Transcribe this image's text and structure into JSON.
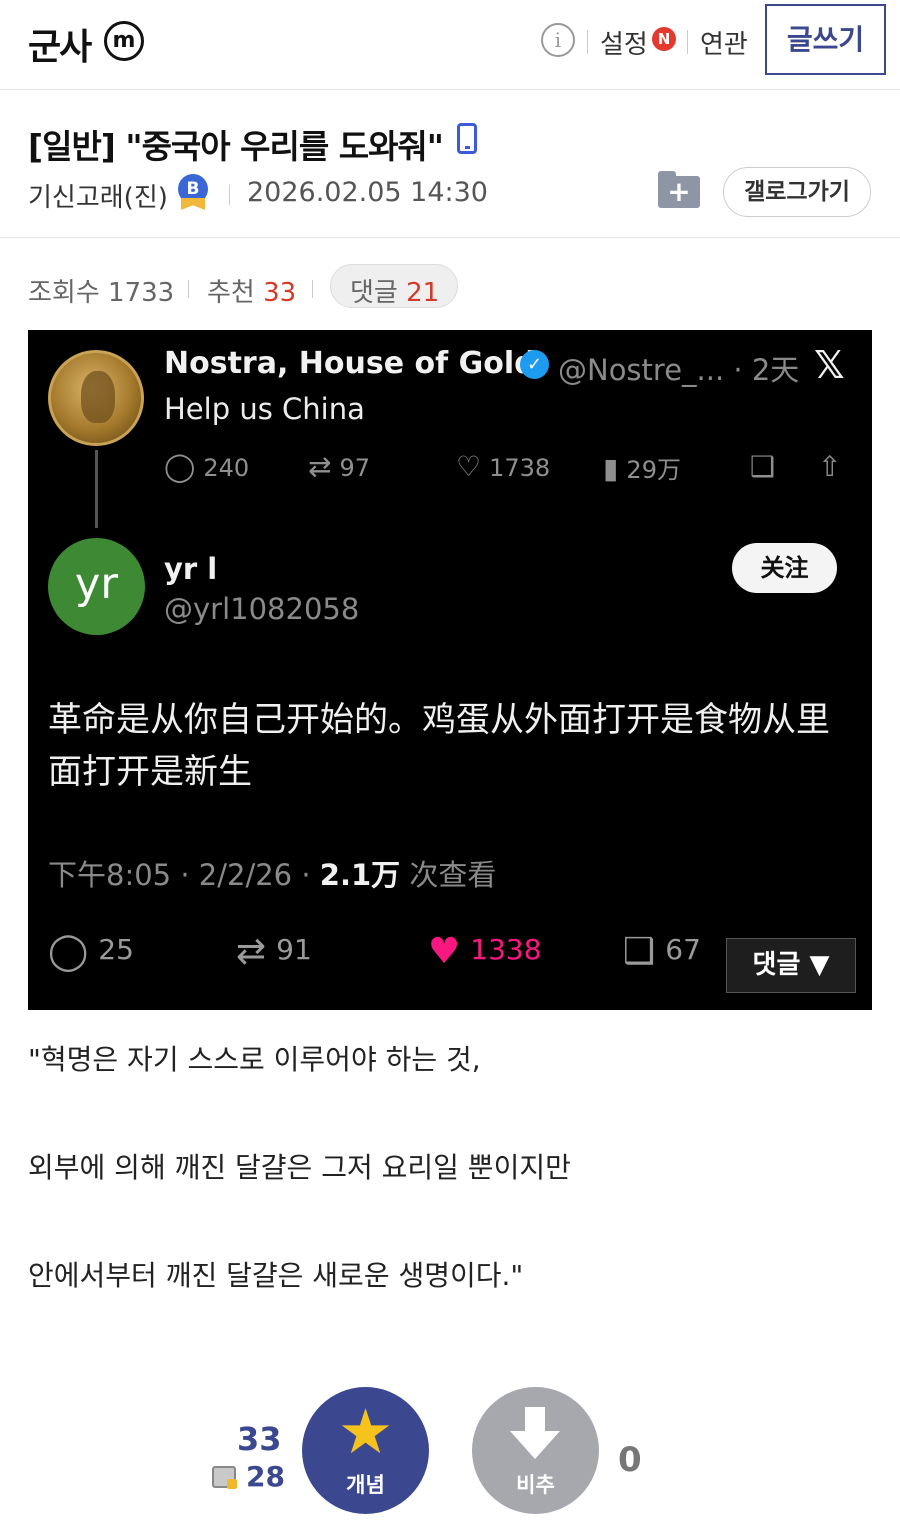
{
  "header": {
    "logo": "군사",
    "logo_mark": "m",
    "info_icon": "i",
    "settings_label": "설정",
    "new_badge": "N",
    "related_label": "연관",
    "write_label": "글쓰기"
  },
  "post": {
    "title": "[일반] \"중국아 우리를 도와줘\"",
    "author": "기신고래(진)",
    "author_badge": "B",
    "date": "2026.02.05 14:30",
    "gallery_button": "갤로그가기",
    "stats": {
      "views_label": "조회수",
      "views": "1733",
      "recommend_label": "추천",
      "recommend": "33",
      "comments_label": "댓글",
      "comments": "21"
    }
  },
  "tweet": {
    "name": "Nostra, House of Gold",
    "verified_icon": "✓",
    "handle_time": "@Nostre_... · 2天",
    "x_logo": "𝕏",
    "text": "Help us China",
    "metrics": {
      "replies": "240",
      "retweets": "97",
      "likes": "1738",
      "views": "29万"
    },
    "reply": {
      "avatar_text": "yr",
      "name": "yr l",
      "handle": "@yrl1082058",
      "follow_label": "关注",
      "body": "革命是从你自己开始的。鸡蛋从外面打开是食物从里面打开是新生",
      "meta_time": "下午8:05 · 2/2/26 · ",
      "meta_views": "2.1万",
      "meta_views_suffix": " 次查看",
      "replies": "25",
      "retweets": "91",
      "likes": "1338",
      "bookmarks": "67"
    },
    "comment_overlay": "댓글 ▼"
  },
  "body_lines": [
    "\"혁명은 자기 스스로 이루어야 하는 것,",
    "외부에 의해 깨진 달걀은 그저 요리일 뿐이지만",
    "안에서부터 깨진 달걀은 새로운 생명이다.\""
  ],
  "vote": {
    "up_count": "33",
    "fixed_count": "28",
    "up_label": "개념",
    "down_label": "비추",
    "down_count": "0"
  },
  "colors": {
    "brand": "#3b4890",
    "accent_red": "#d23a2a",
    "like_pink": "#f91880"
  }
}
